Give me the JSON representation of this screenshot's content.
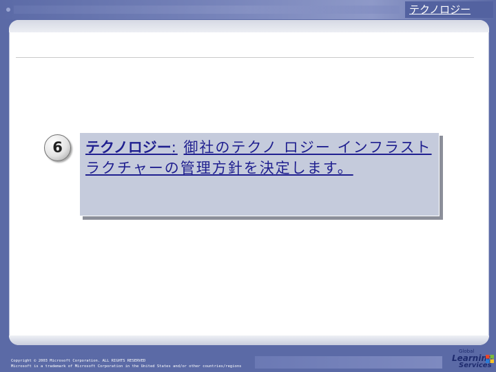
{
  "header": {
    "title_link": "テクノロジー"
  },
  "step": {
    "number": "6"
  },
  "callout": {
    "keyword": "テクノロジー",
    "separator": ":",
    "line1": "御社のテクノ ロジー インフラスト",
    "line2": "ラクチャーの管理方針を決定します。"
  },
  "footer": {
    "copyright_line1": "Copyright © 2003 Microsoft Corporation. ALL RIGHTS RESERVED",
    "copyright_line2": "Microsoft is a trademark of Microsoft Corporation in the United States and/or other countries/regions",
    "logo": {
      "global": "Global",
      "learning": "Learning",
      "services": "Services"
    }
  },
  "colors": {
    "background": "#5b6aa6",
    "callout_fill": "#c5cbdc",
    "callout_text": "#1f1f8f"
  },
  "icons": {
    "step_badge": "circle-number-badge",
    "logo_flag": "windows-flag-icon"
  }
}
